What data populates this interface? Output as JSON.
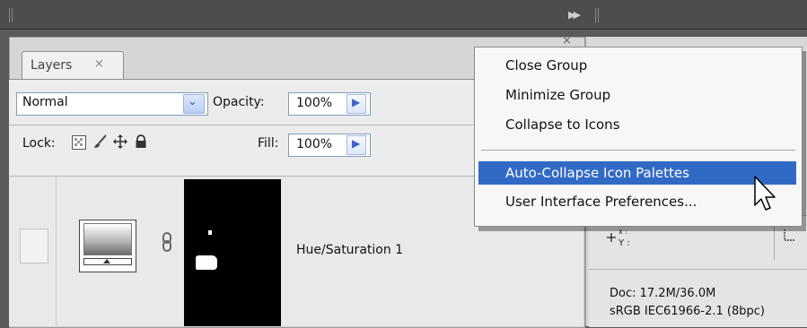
{
  "layers_panel": {
    "tab_label": "Layers",
    "tab_close": "×",
    "blend_mode": "Normal",
    "opacity_label": "Opacity:",
    "opacity_value": "100%",
    "lock_label": "Lock:",
    "fill_label": "Fill:",
    "fill_value": "100%",
    "layer_name": "Hue/Saturation 1"
  },
  "panel_close": "×",
  "info_panel": {
    "xy_label": "+, X :\n   Y :",
    "doc_size": "Doc: 17.2M/36.0M",
    "color_profile": "sRGB IEC61966-2.1 (8bpc)"
  },
  "context_menu": {
    "items": [
      {
        "label": "Close Group"
      },
      {
        "label": "Minimize Group"
      },
      {
        "label": "Collapse to Icons"
      },
      {
        "label": "Auto-Collapse Icon Palettes",
        "highlighted": true
      },
      {
        "label": "User Interface Preferences..."
      }
    ]
  },
  "colors": {
    "highlight": "#316ac5",
    "accent_arrow": "#3b64c8"
  },
  "icons": {
    "lock_transparency": "checkerboard-icon",
    "lock_pixels": "brush-icon",
    "lock_position": "move-icon",
    "lock_all": "padlock-icon",
    "link": "chain-link-icon",
    "collapse_panels": "double-arrow-icon"
  }
}
